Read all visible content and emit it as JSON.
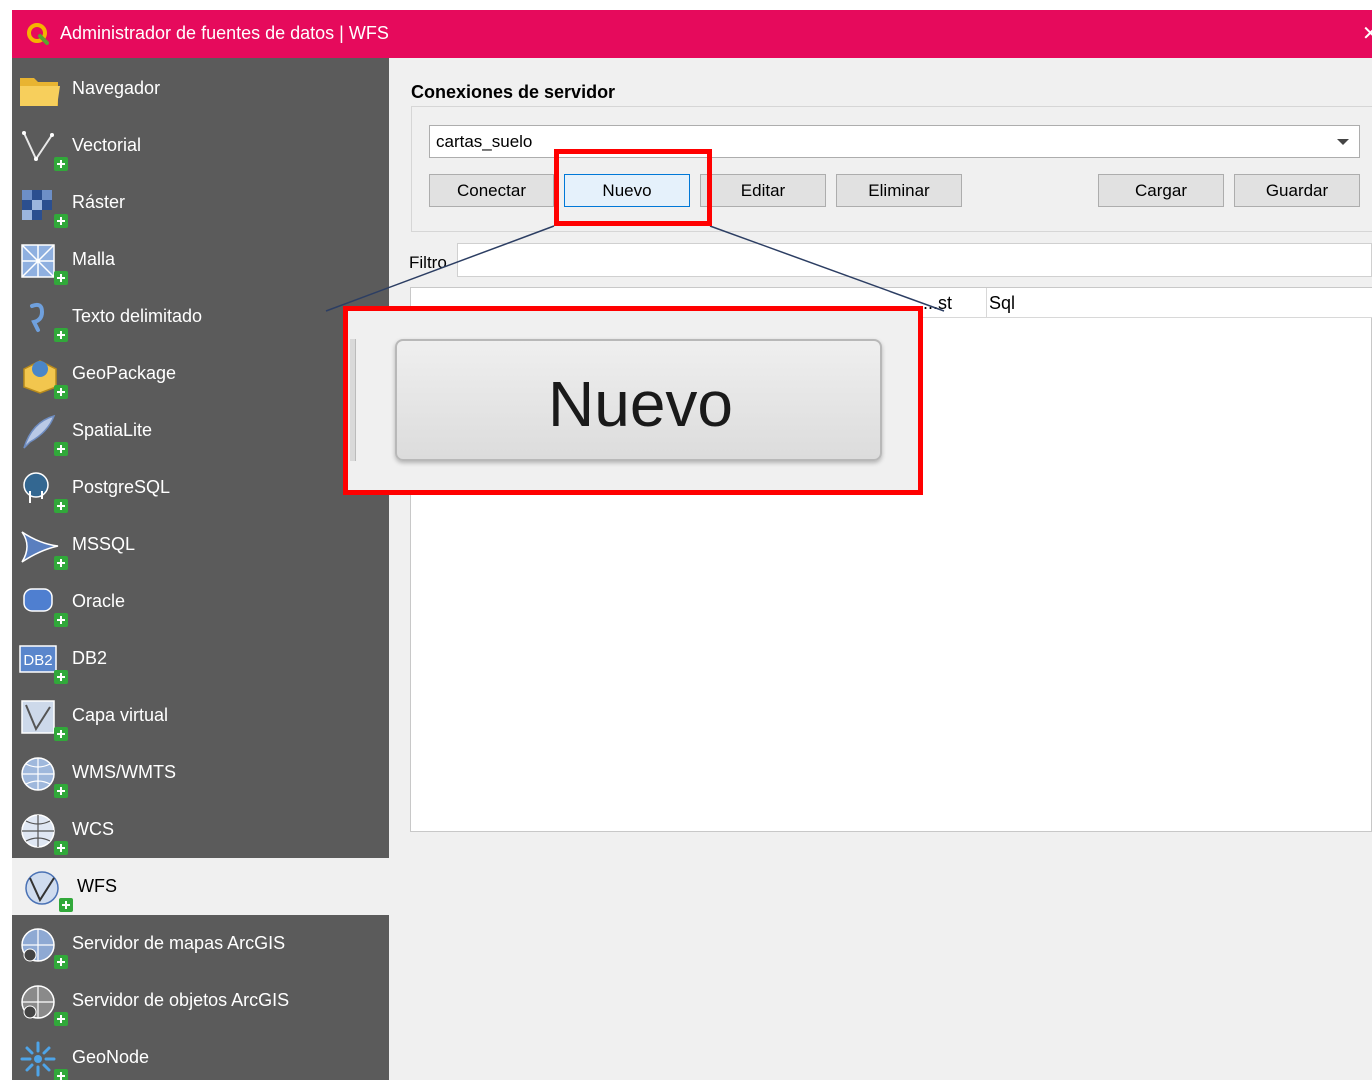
{
  "window": {
    "title": "Administrador de fuentes de datos | WFS",
    "close_glyph": "✕",
    "titlebar_color": "#e60a5c"
  },
  "sidebar": {
    "background": "#5b5b5b",
    "items": [
      {
        "label": "Navegador",
        "icon": "folder-icon"
      },
      {
        "label": "Vectorial",
        "icon": "vector-layer-icon"
      },
      {
        "label": "Ráster",
        "icon": "raster-layer-icon"
      },
      {
        "label": "Malla",
        "icon": "mesh-layer-icon"
      },
      {
        "label": "Texto delimitado",
        "icon": "delimited-text-icon"
      },
      {
        "label": "GeoPackage",
        "icon": "geopackage-icon"
      },
      {
        "label": "SpatiaLite",
        "icon": "spatialite-icon"
      },
      {
        "label": "PostgreSQL",
        "icon": "postgresql-icon"
      },
      {
        "label": "MSSQL",
        "icon": "mssql-icon"
      },
      {
        "label": "Oracle",
        "icon": "oracle-icon"
      },
      {
        "label": "DB2",
        "icon": "db2-icon"
      },
      {
        "label": "Capa virtual",
        "icon": "virtual-layer-icon"
      },
      {
        "label": "WMS/WMTS",
        "icon": "wms-globe-icon"
      },
      {
        "label": "WCS",
        "icon": "wcs-globe-icon"
      },
      {
        "label": "WFS",
        "icon": "wfs-globe-icon",
        "active": true
      },
      {
        "label": "Servidor de mapas ArcGIS",
        "icon": "arcgis-map-server-icon"
      },
      {
        "label": "Servidor de objetos ArcGIS",
        "icon": "arcgis-feature-server-icon"
      },
      {
        "label": "GeoNode",
        "icon": "geonode-icon"
      }
    ]
  },
  "main": {
    "section_title": "Conexiones de servidor",
    "connection_combo": {
      "value": "cartas_suelo"
    },
    "buttons": {
      "connect": "Conectar",
      "new": "Nuevo",
      "edit": "Editar",
      "delete": "Eliminar",
      "load": "Cargar",
      "save": "Guardar"
    },
    "filter_label": "Filtro",
    "table": {
      "partial_header": "...st",
      "sql_header": "Sql"
    }
  },
  "annotation": {
    "zoom_label": "Nuevo",
    "highlight_color": "#ff0000"
  }
}
